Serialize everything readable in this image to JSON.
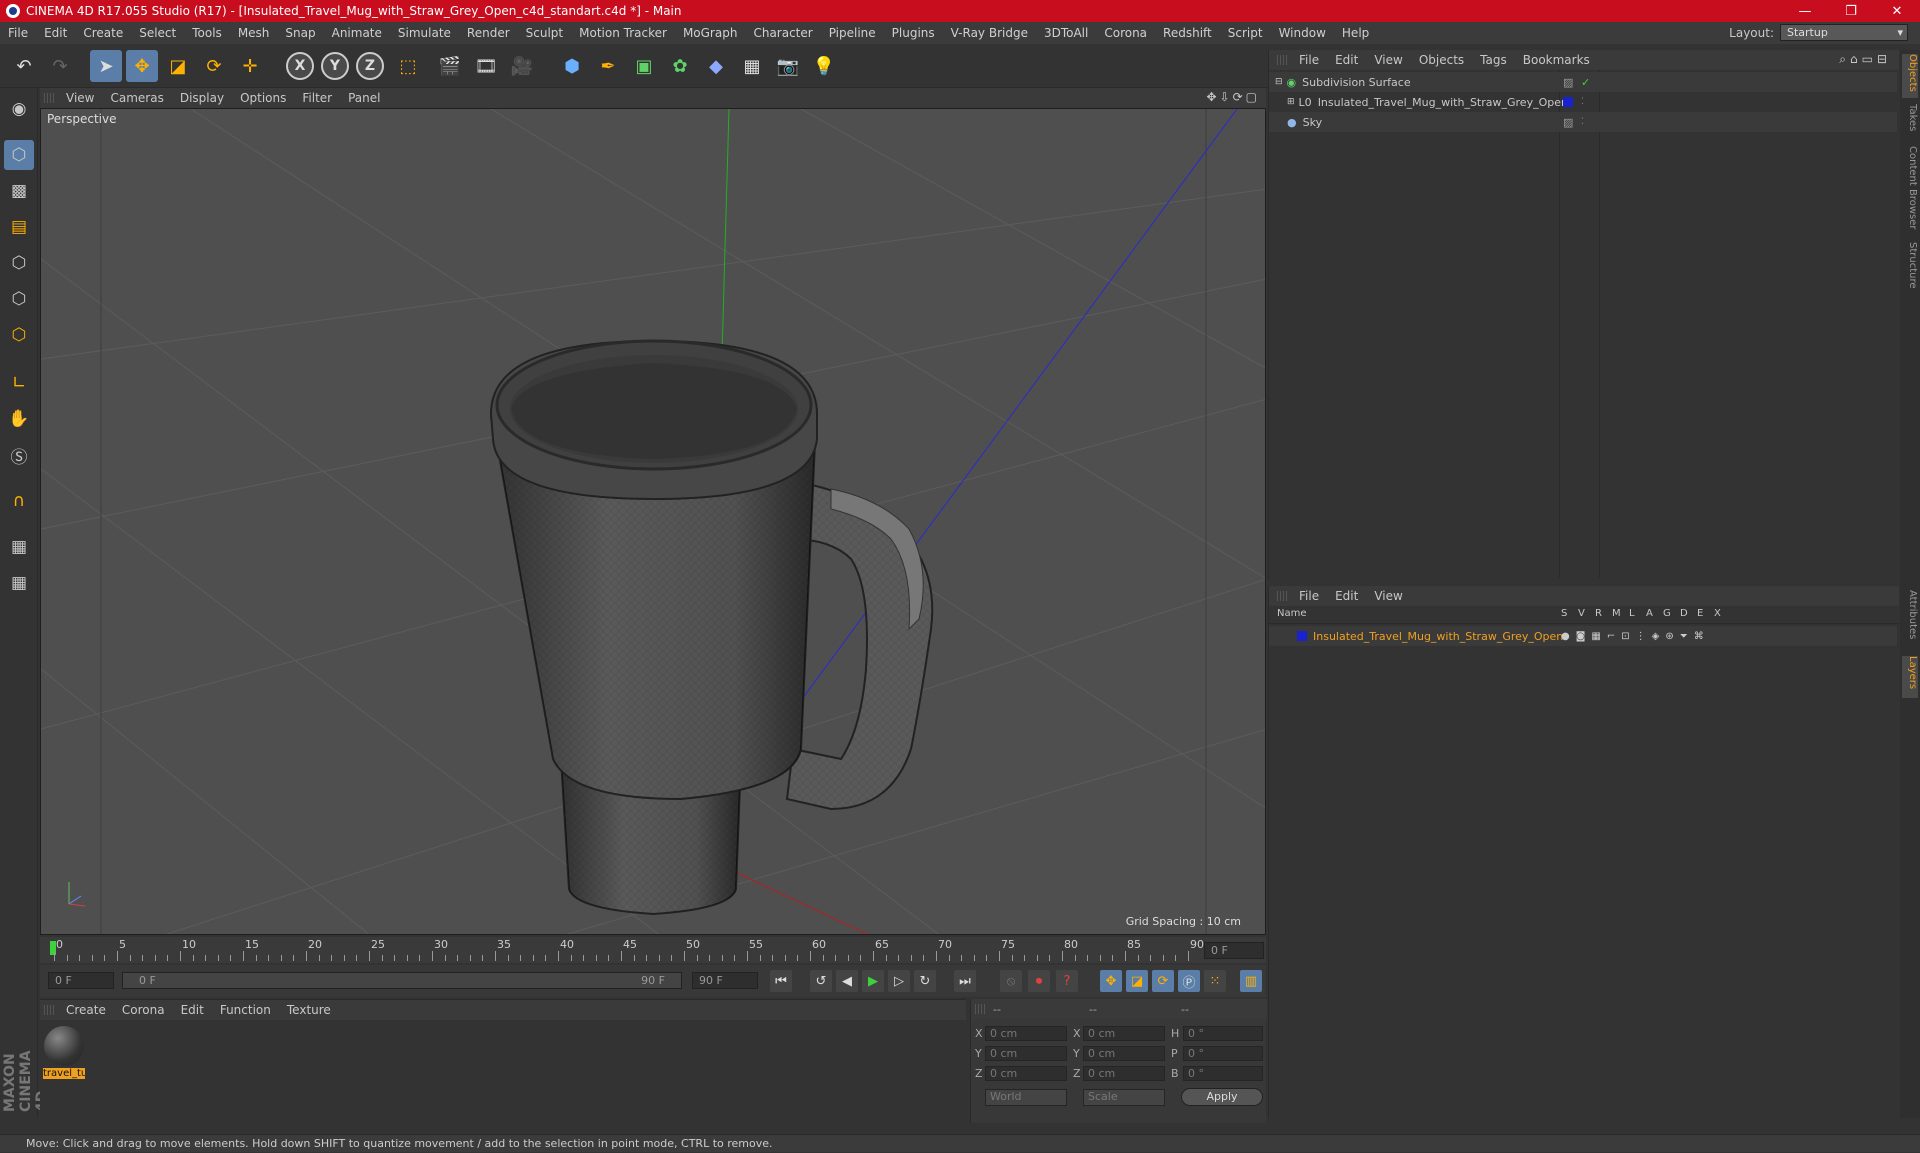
{
  "window": {
    "title": "CINEMA 4D R17.055 Studio (R17) - [Insulated_Travel_Mug_with_Straw_Grey_Open_c4d_standart.c4d *] - Main",
    "minimize": "—",
    "maximize": "❐",
    "close": "✕"
  },
  "menubar": {
    "items": [
      "File",
      "Edit",
      "Create",
      "Select",
      "Tools",
      "Mesh",
      "Snap",
      "Animate",
      "Simulate",
      "Render",
      "Sculpt",
      "Motion Tracker",
      "MoGraph",
      "Character",
      "Pipeline",
      "Plugins",
      "V-Ray Bridge",
      "3DToAll",
      "Corona",
      "Redshift",
      "Script",
      "Window",
      "Help"
    ],
    "layout_label": "Layout:",
    "layout_value": "Startup"
  },
  "viewport": {
    "menu": [
      "View",
      "Cameras",
      "Display",
      "Options",
      "Filter",
      "Panel"
    ],
    "label": "Perspective",
    "grid_spacing": "Grid Spacing : 10 cm"
  },
  "timeline": {
    "ticks": [
      "0",
      "5",
      "10",
      "15",
      "20",
      "25",
      "30",
      "35",
      "40",
      "45",
      "50",
      "55",
      "60",
      "65",
      "70",
      "75",
      "80",
      "85",
      "90"
    ],
    "end_field": "0 F"
  },
  "playback": {
    "start": "0 F",
    "range_start": "0 F",
    "range_end": "90 F",
    "end": "90 F"
  },
  "material_panel": {
    "menu": [
      "Create",
      "Corona",
      "Edit",
      "Function",
      "Texture"
    ],
    "material_name": "travel_tu"
  },
  "coords": {
    "header": [
      "--",
      "--",
      "--"
    ],
    "rows": [
      {
        "a": "X",
        "av": "0 cm",
        "b": "X",
        "bv": "0 cm",
        "c": "H",
        "cv": "0 °"
      },
      {
        "a": "Y",
        "av": "0 cm",
        "b": "Y",
        "bv": "0 cm",
        "c": "P",
        "cv": "0 °"
      },
      {
        "a": "Z",
        "av": "0 cm",
        "b": "Z",
        "bv": "0 cm",
        "c": "B",
        "cv": "0 °"
      }
    ],
    "world": "World",
    "scale": "Scale",
    "apply": "Apply"
  },
  "object_manager": {
    "menu": [
      "File",
      "Edit",
      "View",
      "Objects",
      "Tags",
      "Bookmarks"
    ],
    "objects": [
      {
        "name": "Subdivision Surface"
      },
      {
        "name": "Insulated_Travel_Mug_with_Straw_Grey_Open"
      },
      {
        "name": "Sky"
      }
    ]
  },
  "layer_manager": {
    "menu": [
      "File",
      "Edit",
      "View"
    ],
    "columns": [
      "Name",
      "S",
      "V",
      "R",
      "M",
      "L",
      "A",
      "G",
      "D",
      "E",
      "X"
    ],
    "layer": "Insulated_Travel_Mug_with_Straw_Grey_Open"
  },
  "right_tabs": [
    "Objects",
    "Takes",
    "Content Browser",
    "Structure",
    "Attributes",
    "Layers"
  ],
  "brand": "MAXON CINEMA 4D",
  "status": "Move: Click and drag to move elements. Hold down SHIFT to quantize movement / add to the selection in point mode, CTRL to remove.",
  "colors": {
    "accent": "#5a7ea8",
    "title_bg": "#c80d1e",
    "layer_text": "#f0a020"
  }
}
